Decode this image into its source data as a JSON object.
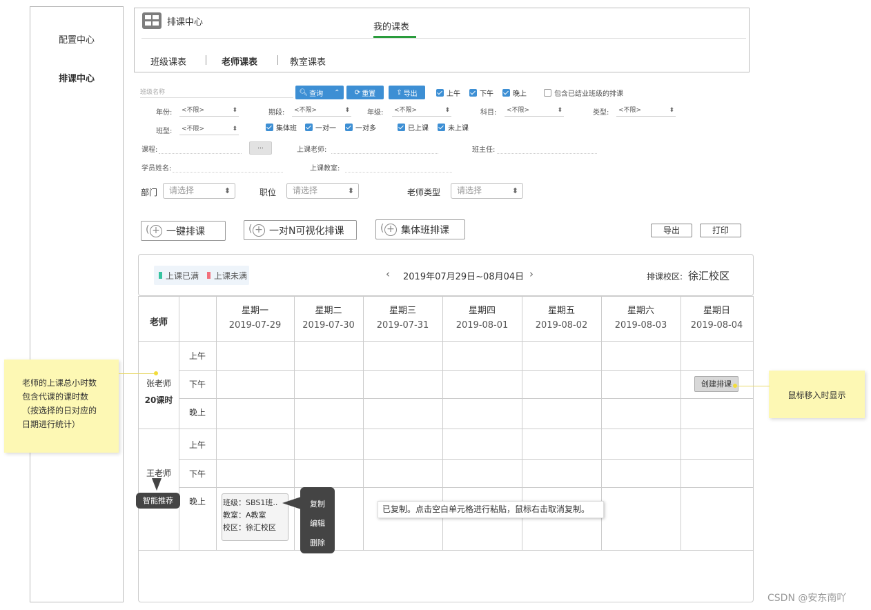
{
  "sidebar": {
    "items": [
      "配置中心",
      "排课中心"
    ]
  },
  "header": {
    "app_title": "排课中心",
    "tabs": [
      "我的课表"
    ],
    "sub_tabs": [
      "班级课表",
      "老师课表",
      "教室课表"
    ]
  },
  "filters": {
    "class_name_placeholder": "班级名称",
    "query_label": "查询",
    "reset_label": "重置",
    "export_label": "导出",
    "time_checks": [
      "上午",
      "下午",
      "晚上"
    ],
    "include_graduated": "包含已结业班级的排课",
    "row2": [
      {
        "label": "年份:",
        "value": "<不限>"
      },
      {
        "label": "期段:",
        "value": "<不限>"
      },
      {
        "label": "年级:",
        "value": "<不限>"
      },
      {
        "label": "科目:",
        "value": "<不限>"
      },
      {
        "label": "类型:",
        "value": "<不限>"
      }
    ],
    "class_type_label": "班型:",
    "class_type_value": "<不限>",
    "type_checks": [
      "集体班",
      "一对一",
      "一对多"
    ],
    "status_checks": [
      "已上课",
      "未上课"
    ],
    "course_label": "课程:",
    "more_label": "...",
    "teacher_label": "上课老师:",
    "head_teacher_label": "班主任:",
    "student_label": "学员姓名:",
    "room_label": "上课教室:",
    "dept_label": "部门",
    "position_label": "职位",
    "teacher_type_label": "老师类型",
    "select_placeholder": "请选择"
  },
  "actions": {
    "one_click": "一键排课",
    "one_to_n": "一对N可视化排课",
    "group": "集体班排课",
    "export": "导出",
    "print": "打印"
  },
  "calendar": {
    "legend_full": "上课已满",
    "legend_not_full": "上课未满",
    "full_color": "#36c3a0",
    "not_full_color": "#f2707c",
    "date_range": "2019年07月29日~08月04日",
    "campus_label": "排课校区:",
    "campus_value": "徐汇校区",
    "teacher_header": "老师",
    "days": [
      {
        "name": "星期一",
        "date": "2019-07-29"
      },
      {
        "name": "星期二",
        "date": "2019-07-30"
      },
      {
        "name": "星期三",
        "date": "2019-07-31"
      },
      {
        "name": "星期四",
        "date": "2019-08-01"
      },
      {
        "name": "星期五",
        "date": "2019-08-02"
      },
      {
        "name": "星期六",
        "date": "2019-08-03"
      },
      {
        "name": "星期日",
        "date": "2019-08-04"
      }
    ],
    "periods": [
      "上午",
      "下午",
      "晚上"
    ],
    "teachers": [
      {
        "name": "张老师",
        "hours": "20课时"
      },
      {
        "name": "王老师"
      }
    ],
    "create_label": "创建排课",
    "smart_label": "智能推荐",
    "course_card": {
      "class": "班级：SBS1班..",
      "room": "教室：A教室",
      "campus": "校区：徐汇校区"
    },
    "menu": [
      "复制",
      "编辑",
      "删除"
    ],
    "copied_tip": "已复制。点击空白单元格进行粘贴，鼠标右击取消复制。"
  },
  "notes": {
    "left": [
      "老师的上课总小时数",
      "包含代课的课时数",
      "（按选择的日对应的",
      "日期进行统计）"
    ],
    "right": "鼠标移入时显示"
  },
  "watermark": "CSDN @安东南吖"
}
